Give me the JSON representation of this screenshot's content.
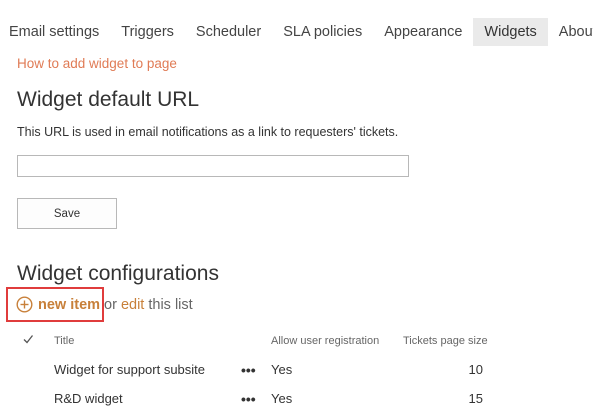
{
  "tabs": [
    {
      "label": "Email settings",
      "active": false
    },
    {
      "label": "Triggers",
      "active": false
    },
    {
      "label": "Scheduler",
      "active": false
    },
    {
      "label": "SLA policies",
      "active": false
    },
    {
      "label": "Appearance",
      "active": false
    },
    {
      "label": "Widgets",
      "active": true
    },
    {
      "label": "About",
      "active": false
    }
  ],
  "help_link": "How to add widget to page",
  "default_url": {
    "heading": "Widget default URL",
    "description": "This URL is used in email notifications as a link to requesters' tickets.",
    "input_value": "",
    "save_label": "Save"
  },
  "configurations": {
    "heading": "Widget configurations",
    "new_item_label": "new item",
    "or_text": "or",
    "edit_label": "edit",
    "list_text": "this list",
    "columns": {
      "title": "Title",
      "allow_registration": "Allow user registration",
      "page_size": "Tickets page size"
    },
    "rows": [
      {
        "title": "Widget for support subsite",
        "menu": "•••",
        "allow_registration": "Yes",
        "page_size": "10"
      },
      {
        "title": "R&D widget",
        "menu": "•••",
        "allow_registration": "Yes",
        "page_size": "15"
      }
    ]
  },
  "colors": {
    "accent_link": "#e07b55",
    "action_link": "#c8803a",
    "highlight_box": "#e03c3c",
    "active_tab_bg": "#eaeaea"
  }
}
